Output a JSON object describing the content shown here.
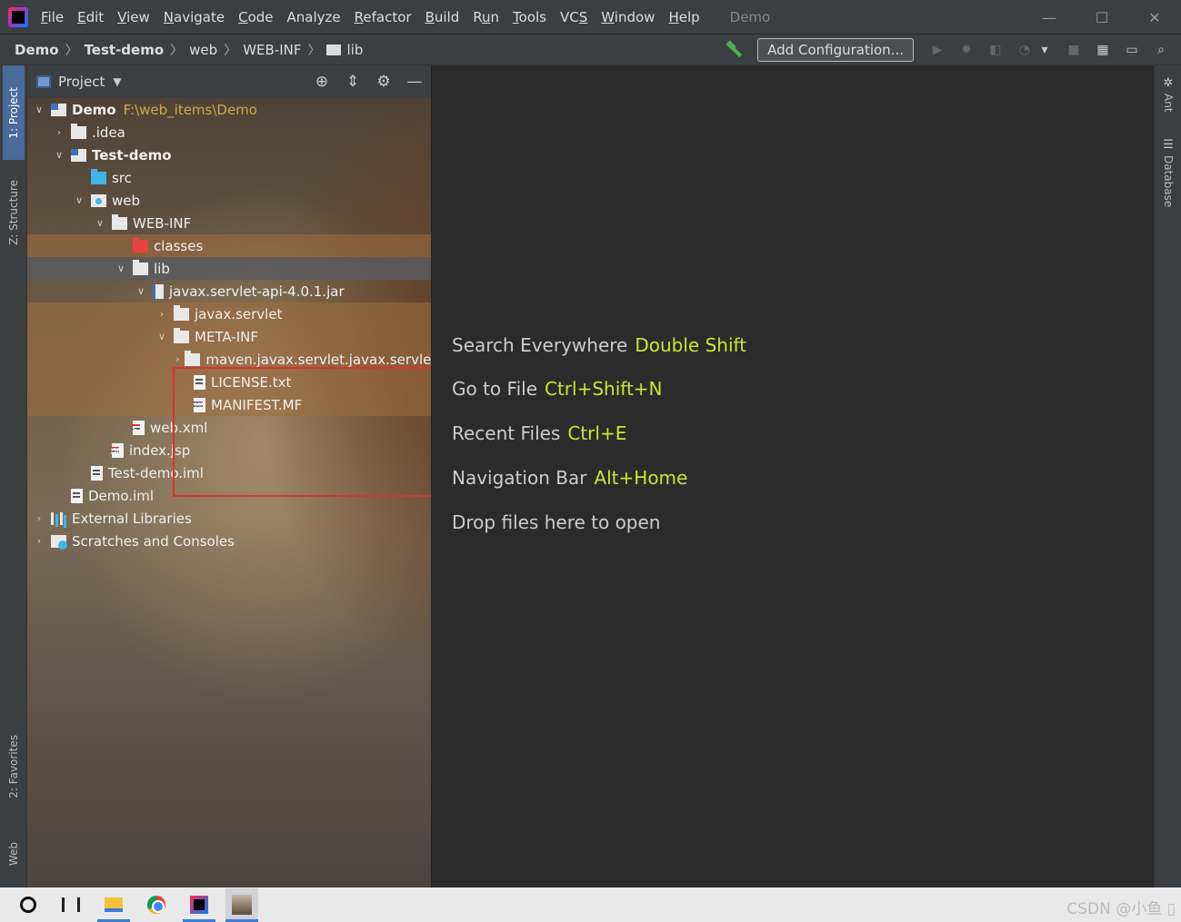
{
  "menubar": {
    "items": [
      {
        "label": "File",
        "u": "F"
      },
      {
        "label": "Edit",
        "u": "E"
      },
      {
        "label": "View",
        "u": "V"
      },
      {
        "label": "Navigate",
        "u": "N"
      },
      {
        "label": "Code",
        "u": "C"
      },
      {
        "label": "Analyze",
        "u": ""
      },
      {
        "label": "Refactor",
        "u": "R"
      },
      {
        "label": "Build",
        "u": "B"
      },
      {
        "label": "Run",
        "u": "u"
      },
      {
        "label": "Tools",
        "u": "T"
      },
      {
        "label": "VCS",
        "u": "S"
      },
      {
        "label": "Window",
        "u": "W"
      },
      {
        "label": "Help",
        "u": "H"
      }
    ],
    "project_name": "Demo",
    "minimize": "—",
    "maximize": "☐",
    "close": "✕"
  },
  "navbar": {
    "crumbs": [
      "Demo",
      "Test-demo",
      "web",
      "WEB-INF",
      "lib"
    ],
    "separator": "〉",
    "add_configuration": "Add Configuration..."
  },
  "left_stripe": {
    "project_tab": "1: Project",
    "structure_tab": "Z: Structure",
    "favorites_tab": "2: Favorites",
    "web_tab": "Web"
  },
  "right_stripe": {
    "ant_tab": "Ant",
    "database_tab": "Database"
  },
  "project_panel": {
    "title": "Project",
    "tree": [
      {
        "label": "Demo",
        "path": "F:\\web_items\\Demo"
      },
      {
        "label": ".idea"
      },
      {
        "label": "Test-demo"
      },
      {
        "label": "src"
      },
      {
        "label": "web"
      },
      {
        "label": "WEB-INF"
      },
      {
        "label": "classes"
      },
      {
        "label": "lib"
      },
      {
        "label": "javax.servlet-api-4.0.1.jar"
      },
      {
        "label": "javax.servlet"
      },
      {
        "label": "META-INF"
      },
      {
        "label": "maven.javax.servlet.javax.servlet-api"
      },
      {
        "label": "LICENSE.txt"
      },
      {
        "label": "MANIFEST.MF"
      },
      {
        "label": "web.xml"
      },
      {
        "label": "index.jsp"
      },
      {
        "label": "Test-demo.iml"
      },
      {
        "label": "Demo.iml"
      },
      {
        "label": "External Libraries"
      },
      {
        "label": "Scratches and Consoles"
      }
    ]
  },
  "welcome": {
    "tips": [
      {
        "text": "Search Everywhere",
        "key": "Double Shift"
      },
      {
        "text": "Go to File",
        "key": "Ctrl+Shift+N"
      },
      {
        "text": "Recent Files",
        "key": "Ctrl+E"
      },
      {
        "text": "Navigation Bar",
        "key": "Alt+Home"
      },
      {
        "text": "Drop files here to open",
        "key": ""
      }
    ]
  },
  "taskbar": {
    "watermark": "CSDN @小鱼 ▯"
  },
  "colors": {
    "accent_key": "#c8e632",
    "path_text": "#d4a84a",
    "highlight_box": "#e03030"
  }
}
